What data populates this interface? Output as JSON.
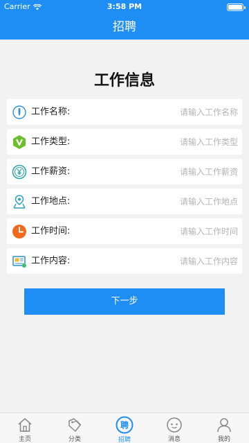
{
  "status": {
    "carrier": "Carrier",
    "time": "3:58 PM"
  },
  "nav": {
    "title": "招聘"
  },
  "heading": "工作信息",
  "fields": [
    {
      "icon": "job-name-icon",
      "label": "工作名称:",
      "placeholder": "请输入工作名称"
    },
    {
      "icon": "job-type-icon",
      "label": "工作类型:",
      "placeholder": "请输入工作类型"
    },
    {
      "icon": "salary-icon",
      "label": "工作薪资:",
      "placeholder": "请输入工作薪资"
    },
    {
      "icon": "location-icon",
      "label": "工作地点:",
      "placeholder": "请输入工作地点"
    },
    {
      "icon": "clock-icon",
      "label": "工作时间:",
      "placeholder": "请输入工作时间"
    },
    {
      "icon": "content-icon",
      "label": "工作内容:",
      "placeholder": "请输入工作内容"
    }
  ],
  "next_button": "下一步",
  "tabs": [
    {
      "icon": "home-icon",
      "label": "主页",
      "active": false
    },
    {
      "icon": "category-icon",
      "label": "分类",
      "active": false
    },
    {
      "icon": "recruit-icon",
      "label": "招聘",
      "active": true,
      "icon_text": "聘"
    },
    {
      "icon": "message-icon",
      "label": "消息",
      "active": false
    },
    {
      "icon": "profile-icon",
      "label": "我的",
      "active": false
    }
  ],
  "colors": {
    "brand": "#1e8ef5",
    "background": "#f2f2f2"
  }
}
